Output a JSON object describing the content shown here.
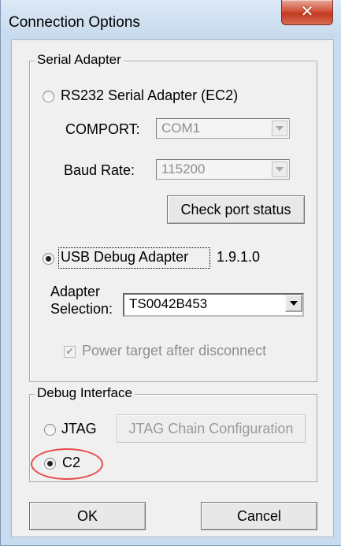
{
  "window": {
    "title": "Connection Options",
    "close_glyph": "✕"
  },
  "serial_group": {
    "label": "Serial Adapter",
    "rs232_label": "RS232 Serial Adapter (EC2)",
    "comport_label": "COMPORT:",
    "comport_value": "COM1",
    "baud_label": "Baud Rate:",
    "baud_value": "115200",
    "check_port_label": "Check port status",
    "usb_label": "USB Debug Adapter",
    "usb_version": "1.9.1.0",
    "adapter_label_line1": "Adapter",
    "adapter_label_line2": "Selection:",
    "adapter_value": "TS0042B453",
    "power_label": "Power target after disconnect",
    "power_checked": true,
    "selected": "usb"
  },
  "debug_group": {
    "label": "Debug Interface",
    "jtag_label": "JTAG",
    "jtag_config_label": "JTAG Chain Configuration",
    "c2_label": "C2",
    "selected": "c2"
  },
  "footer": {
    "ok_label": "OK",
    "cancel_label": "Cancel"
  },
  "colors": {
    "annotation": "#e84a4a",
    "close_button": "#c23a21"
  },
  "icons": {
    "close": "close-icon",
    "dropdown": "chevron-down-icon",
    "check": "checkmark-icon"
  }
}
